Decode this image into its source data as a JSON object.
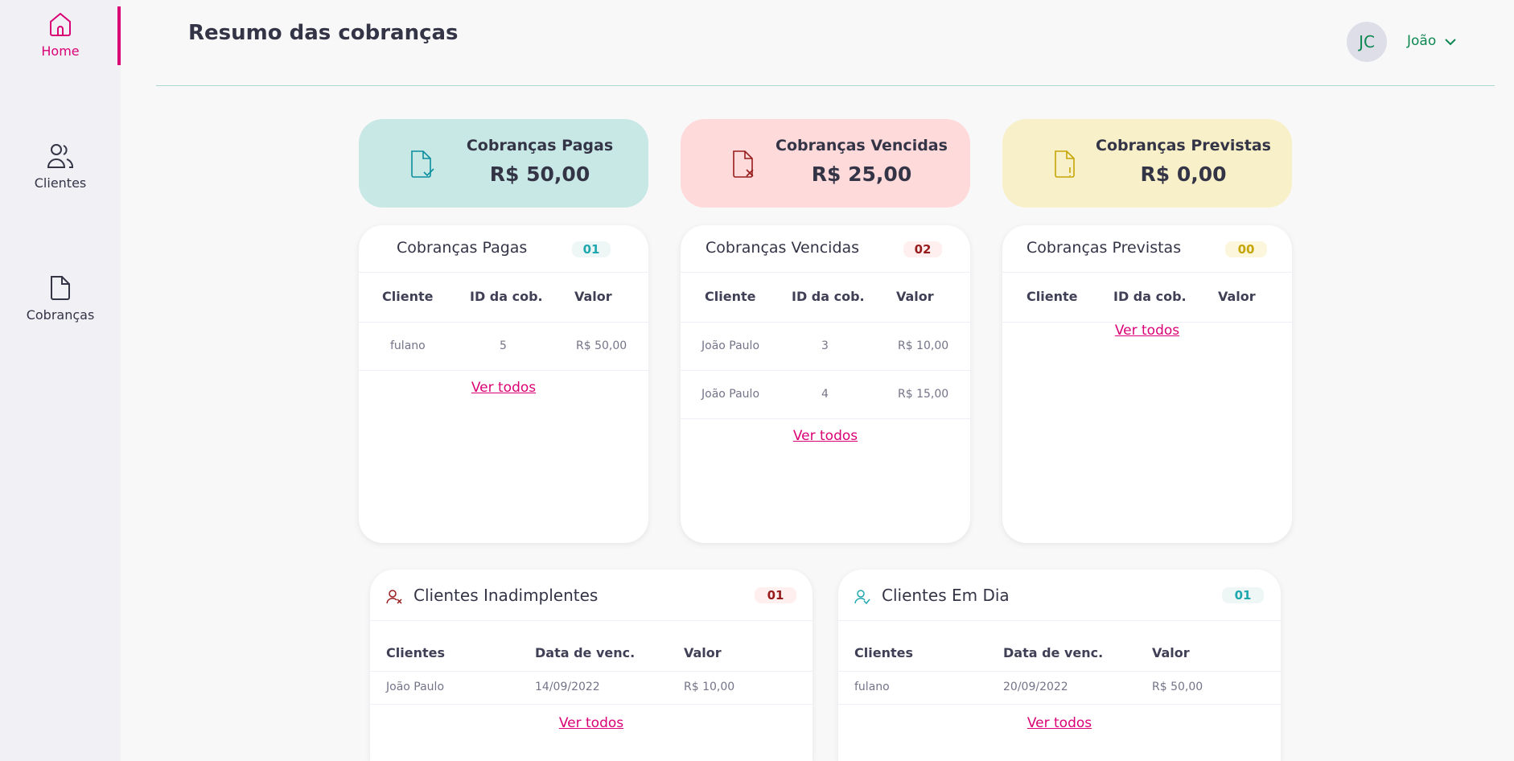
{
  "sidebar": {
    "items": [
      {
        "label": "Home",
        "icon": "home-icon",
        "active": true
      },
      {
        "label": "Clientes",
        "icon": "clients-icon",
        "active": false
      },
      {
        "label": "Cobranças",
        "icon": "document-icon",
        "active": false
      }
    ],
    "accent": "#da0175"
  },
  "header": {
    "title": "Resumo das cobranças",
    "avatar_initials": "JC",
    "user_name": "João"
  },
  "summary": [
    {
      "title": "Cobranças Pagas",
      "value": "R$ 50,00",
      "color": "#c8e8e6",
      "icon": "paid-document-icon"
    },
    {
      "title": "Cobranças Vencidas",
      "value": "R$ 25,00",
      "color": "#ffdadb",
      "icon": "overdue-document-icon"
    },
    {
      "title": "Cobranças Previstas",
      "value": "R$ 0,00",
      "color": "#f8f0c8",
      "icon": "pending-document-icon"
    }
  ],
  "charge_tables": [
    {
      "title": "Cobranças Pagas",
      "badge": "01",
      "columns": [
        "Cliente",
        "ID da cob.",
        "Valor"
      ],
      "rows": [
        [
          "fulano",
          "5",
          "R$ 50,00"
        ]
      ],
      "link": "Ver todos"
    },
    {
      "title": "Cobranças Vencidas",
      "badge": "02",
      "columns": [
        "Cliente",
        "ID da cob.",
        "Valor"
      ],
      "rows": [
        [
          "João Paulo",
          "3",
          "R$ 10,00"
        ],
        [
          "João Paulo",
          "4",
          "R$ 15,00"
        ]
      ],
      "link": "Ver todos"
    },
    {
      "title": "Cobranças Previstas",
      "badge": "00",
      "columns": [
        "Cliente",
        "ID da cob.",
        "Valor"
      ],
      "rows": [],
      "link": "Ver todos"
    }
  ],
  "client_tables": [
    {
      "title": "Clientes Inadimplentes",
      "badge": "01",
      "columns": [
        "Clientes",
        "Data de venc.",
        "Valor"
      ],
      "rows": [
        [
          "João Paulo",
          "14/09/2022",
          "R$ 10,00"
        ]
      ],
      "link": "Ver todos"
    },
    {
      "title": "Clientes Em Dia",
      "badge": "01",
      "columns": [
        "Clientes",
        "Data de venc.",
        "Valor"
      ],
      "rows": [
        [
          "fulano",
          "20/09/2022",
          "R$ 50,00"
        ]
      ],
      "link": "Ver todos"
    }
  ]
}
